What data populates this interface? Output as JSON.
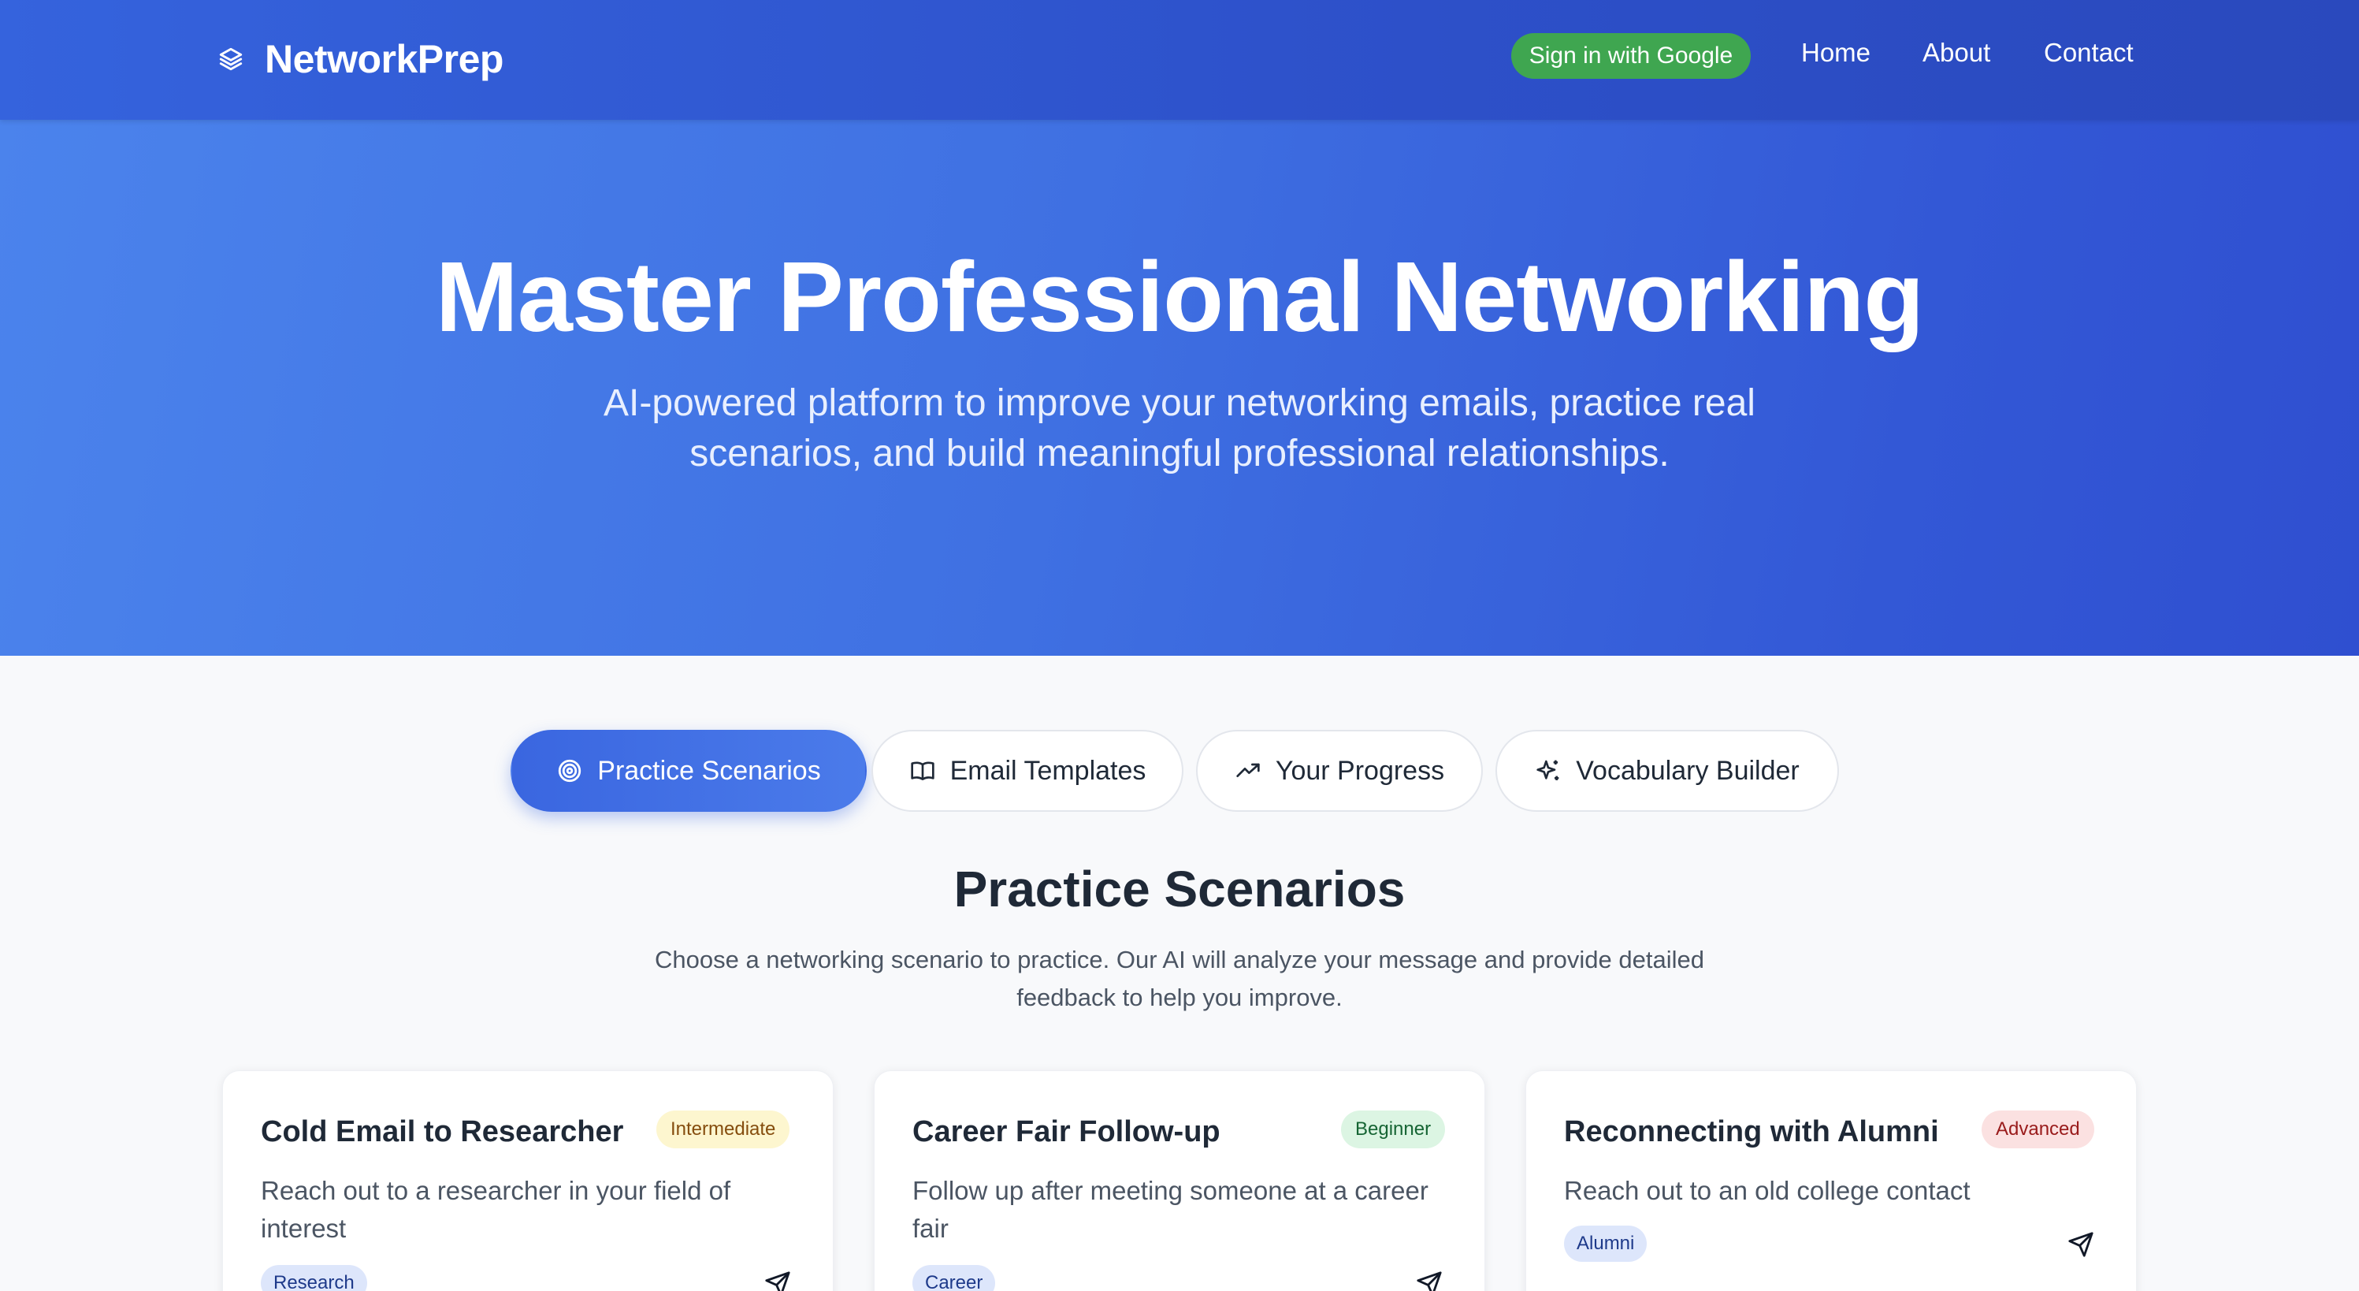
{
  "header": {
    "brand": "NetworkPrep",
    "signin_label": "Sign in with Google",
    "nav": [
      "Home",
      "About",
      "Contact"
    ]
  },
  "hero": {
    "title": "Master Professional Networking",
    "subtitle": "AI-powered platform to improve your networking emails, practice real scenarios, and build meaningful professional relationships."
  },
  "tabs": [
    {
      "label": "Practice Scenarios",
      "icon": "target-icon",
      "active": true
    },
    {
      "label": "Email Templates",
      "icon": "book-open-icon",
      "active": false
    },
    {
      "label": "Your Progress",
      "icon": "trending-up-icon",
      "active": false
    },
    {
      "label": "Vocabulary Builder",
      "icon": "sparkles-icon",
      "active": false
    }
  ],
  "section": {
    "title": "Practice Scenarios",
    "description": "Choose a networking scenario to practice. Our AI will analyze your message and provide detailed feedback to help you improve."
  },
  "cards": [
    {
      "title": "Cold Email to Researcher",
      "level": "Intermediate",
      "description": "Reach out to a researcher in your field of interest",
      "tag": "Research"
    },
    {
      "title": "Career Fair Follow-up",
      "level": "Beginner",
      "description": "Follow up after meeting someone at a career fair",
      "tag": "Career"
    },
    {
      "title": "Reconnecting with Alumni",
      "level": "Advanced",
      "description": "Reach out to an old college contact",
      "tag": "Alumni"
    }
  ],
  "colors": {
    "header_bg": "#2d50c9",
    "hero_bg_start": "#4b83ec",
    "hero_bg_end": "#2f4fd0",
    "signin_green": "#3fa650",
    "active_tab": "#3a66e0",
    "badge_intermediate": "#fdf6cf",
    "badge_beginner": "#dcf5e3",
    "badge_advanced": "#fbe1e1",
    "tag_bg": "#dde6fb"
  }
}
